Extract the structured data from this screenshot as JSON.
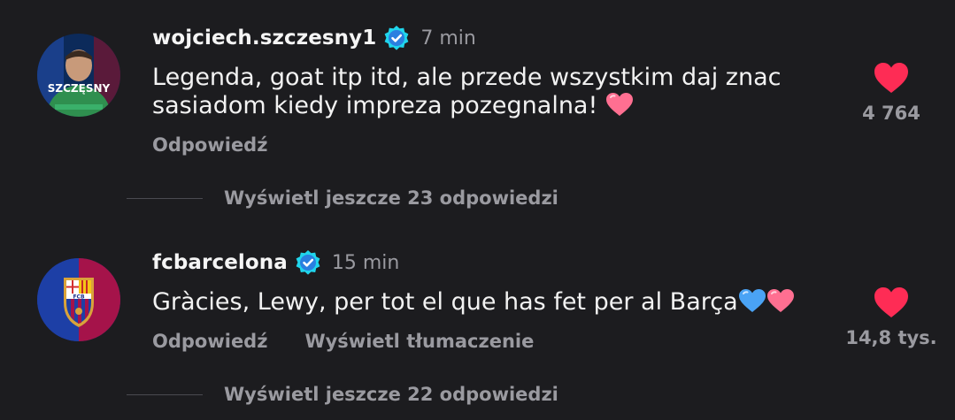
{
  "comments": [
    {
      "username": "wojciech.szczesny1",
      "time": "7 min",
      "text_line1": "Legenda, goat itp itd, ale przede wszystkim daj znac",
      "text_line2": "sasiadom kiedy impreza pozegnalna! ",
      "reply_label": "Odpowiedź",
      "likes": "4 764",
      "avatar_label": "SZCZĘSNY",
      "more_replies": "Wyświetl jeszcze 23 odpowiedzi"
    },
    {
      "username": "fcbarcelona",
      "time": "15 min",
      "text": "Gràcies, Lewy, per tot el que has fet per al Barça",
      "reply_label": "Odpowiedź",
      "translate_label": "Wyświetl tłumaczenie",
      "likes": "14,8 tys.",
      "more_replies": "Wyświetl jeszcze 22 odpowiedzi"
    }
  ],
  "colors": {
    "background": "#1c1c1f",
    "secondary_text": "#9a9aa0",
    "heart": "#fe2c55",
    "verified": "#20d5ec"
  },
  "icons": [
    "verified-badge-icon",
    "heart-icon",
    "pink-heart-emoji",
    "blue-heart-emoji"
  ]
}
